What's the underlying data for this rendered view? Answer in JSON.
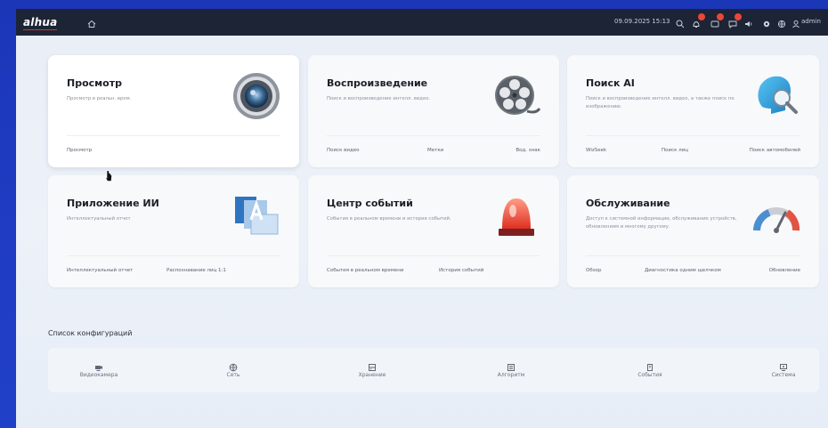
{
  "header": {
    "logo": "alhua",
    "datetime": "09.09.2025 15:13",
    "user": "admin",
    "notifications": [
      {
        "name": "alarm-bell-icon",
        "badge": ""
      },
      {
        "name": "message-icon",
        "badge": ""
      },
      {
        "name": "chat-icon",
        "badge": ""
      }
    ]
  },
  "cards": [
    {
      "title": "Просмотр",
      "desc": "Просмотр в реальн. врем.",
      "links": [
        "Просмотр"
      ]
    },
    {
      "title": "Воспроизведение",
      "desc": "Поиск и воспроизведение интелл. видео.",
      "links": [
        "Поиск видео",
        "Метки",
        "Вод. знак"
      ]
    },
    {
      "title": "Поиск AI",
      "desc": "Поиск и воспроизведение интелл. видео, а также поиск по изображению.",
      "links": [
        "WizSeek",
        "Поиск лиц",
        "Поиск автомобилей"
      ]
    },
    {
      "title": "Приложение ИИ",
      "desc": "Интеллектуальный отчет",
      "links": [
        "Интеллектуальный отчет",
        "Распознавание лиц 1:1"
      ]
    },
    {
      "title": "Центр событий",
      "desc": "События в реальном времени и история событий.",
      "links": [
        "События в реальном времени",
        "История событий"
      ]
    },
    {
      "title": "Обслуживание",
      "desc": "Доступ к системной информации, обслуживание устройств, обновлениям и многому другому.",
      "links": [
        "Обзор",
        "Диагностика одним щелчком",
        "Обновление"
      ]
    }
  ],
  "config": {
    "title": "Список конфигураций",
    "items": [
      "Видеокамера",
      "Сеть",
      "Хранение",
      "Алгоритм",
      "События",
      "Система"
    ]
  },
  "colors": {
    "topbar": "#1d2435",
    "frame": "#1f3dc4",
    "badge": "#e8473a"
  }
}
